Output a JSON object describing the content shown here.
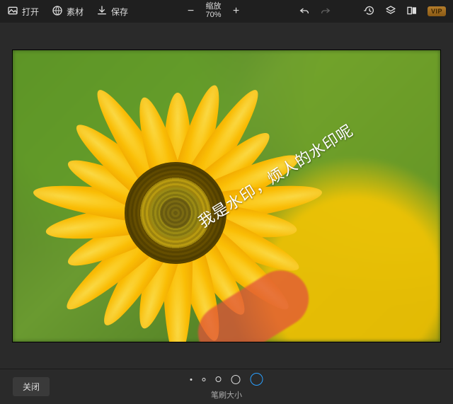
{
  "toolbar": {
    "open_label": "打开",
    "assets_label": "素材",
    "save_label": "保存",
    "zoom_label": "缩放",
    "zoom_value": "70%",
    "minus": "−",
    "plus": "+",
    "vip_label": "VIP"
  },
  "watermark": {
    "text": "我是水印，烦人的水印呢"
  },
  "bottom": {
    "close_label": "关闭",
    "brush_label": "笔刷大小"
  },
  "icons": {
    "open": "open-icon",
    "assets": "globe-icon",
    "save": "download-icon",
    "undo": "undo-icon",
    "redo": "redo-icon",
    "history": "history-icon",
    "layers": "layers-icon",
    "compare": "compare-icon"
  },
  "brush_sizes": [
    1,
    2,
    3,
    4,
    5
  ],
  "brush_selected_index": 4
}
